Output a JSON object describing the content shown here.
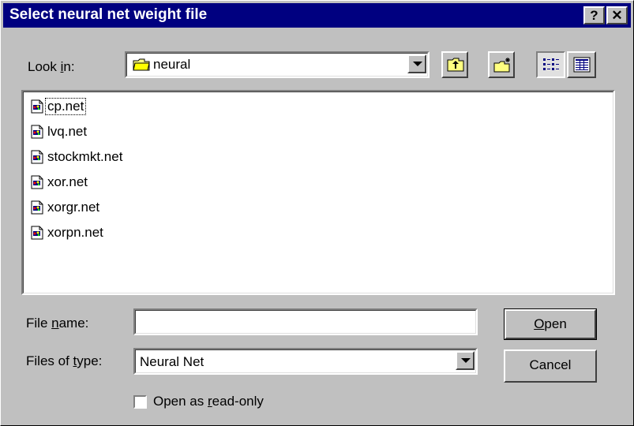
{
  "dialog": {
    "title": "Select neural net weight file",
    "help_glyph": "?",
    "close_glyph": "✕"
  },
  "look_in": {
    "label_prefix": "Look ",
    "label_accel": "i",
    "label_suffix": "n:",
    "folder": "neural"
  },
  "files": [
    {
      "name": "cp.net"
    },
    {
      "name": "lvq.net"
    },
    {
      "name": "stockmkt.net"
    },
    {
      "name": "xor.net"
    },
    {
      "name": "xorgr.net"
    },
    {
      "name": "xorpn.net"
    }
  ],
  "file_name": {
    "label_prefix": "File ",
    "label_accel": "n",
    "label_suffix": "ame:",
    "value": ""
  },
  "file_type": {
    "label_prefix": "Files of ",
    "label_accel": "t",
    "label_suffix": "ype:",
    "value": "Neural Net"
  },
  "buttons": {
    "open_accel": "O",
    "open_rest": "pen",
    "cancel": "Cancel"
  },
  "readonly": {
    "label_prefix": "Open as ",
    "label_accel": "r",
    "label_suffix": "ead-only",
    "checked": false
  }
}
